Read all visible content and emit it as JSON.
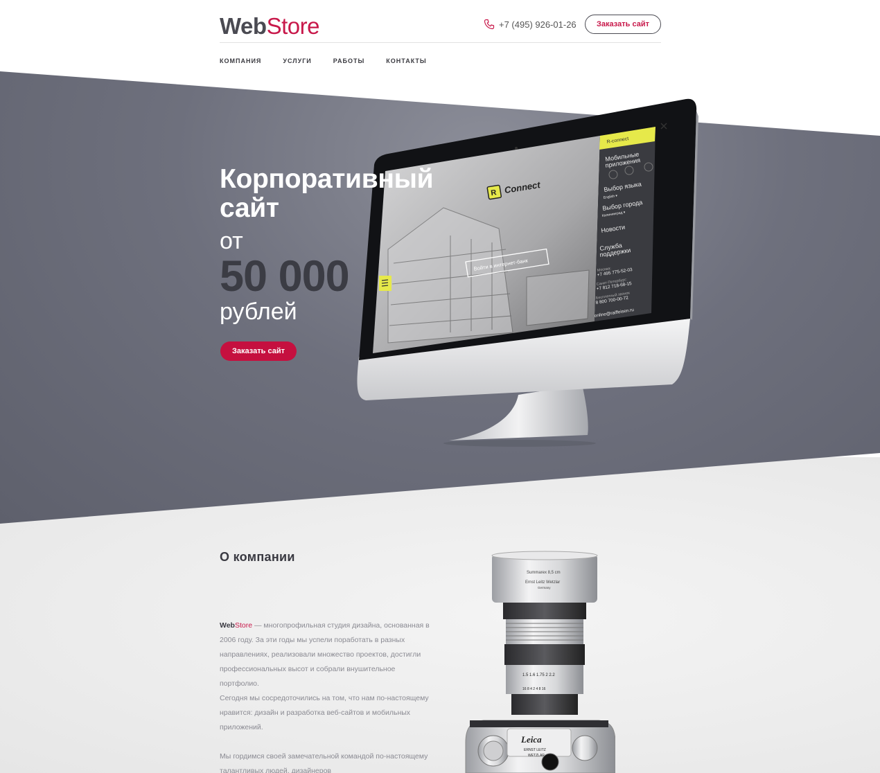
{
  "header": {
    "logo_bold": "Web",
    "logo_light": "Store",
    "phone": "+7 (495) 926-01-26",
    "order_label": "Заказать сайт",
    "phone_icon": "phone-icon"
  },
  "nav": {
    "items": [
      {
        "label": "КОМПАНИЯ"
      },
      {
        "label": "УСЛУГИ"
      },
      {
        "label": "РАБОТЫ"
      },
      {
        "label": "КОНТАКТЫ"
      }
    ]
  },
  "hero": {
    "title_line1": "Корпоративный",
    "title_line2": "сайт",
    "from": "от",
    "price": "50 000",
    "currency": "рублей",
    "order_label": "Заказать сайт"
  },
  "mockup": {
    "brand": "Connect",
    "login_button": "Войти в интернет-банк",
    "menu_header": "R-connect",
    "menu": [
      "Мобильные приложения",
      "Выбор языка",
      "Выбор города",
      "Новости",
      "Служба поддержки"
    ],
    "language": "English",
    "city": "Калининград",
    "email": "online@raiffeisen.ru",
    "phones": [
      "+7 495 775-52-03",
      "+7 812 718-68-15",
      "8 800 700-00-72"
    ]
  },
  "about": {
    "title": "О компании",
    "brand_bold": "Web",
    "brand_light": "Store",
    "p1_rest": " — многопрофильная студия дизайна, основанная в 2006 году. За эти годы мы успели поработать в разных направлениях, реализовали множество проектов, достигли профессиональных высот и собрали внушительное портфолио.",
    "p1_cont": "Сегодня мы сосредоточились на том, что нам по-настоящему нравится: дизайн и разработка веб-сайтов и мобильных приложений.",
    "p2": "Мы гордимся своей замечательной командой по-настоящему талантливых людей, дизайнеров"
  },
  "colors": {
    "accent": "#c8184a",
    "dark": "#4a4a52",
    "hero_bg": "#6e707d",
    "screen_yellow": "#e6e94a"
  }
}
